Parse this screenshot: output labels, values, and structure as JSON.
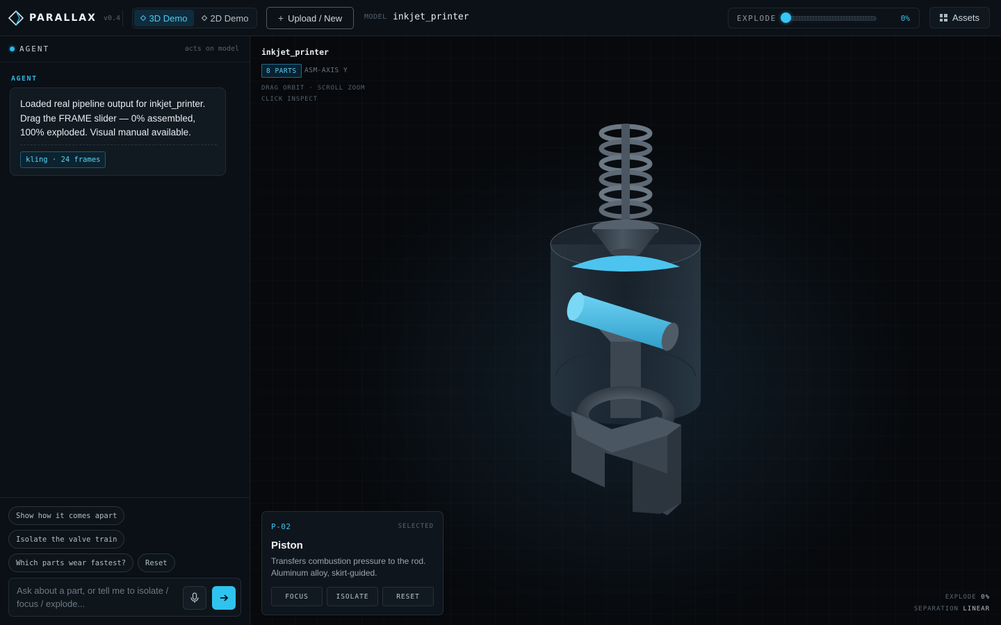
{
  "app": {
    "name": "PARALLAX",
    "version": "v0.4"
  },
  "colors": {
    "accent": "#2fc3f0",
    "background": "#07090c",
    "panel": "#0b1016"
  },
  "topbar": {
    "modes": [
      {
        "label": "3D Demo",
        "active": true,
        "icon": "diamond-icon"
      },
      {
        "label": "2D Demo",
        "active": false,
        "icon": "diamond-icon"
      }
    ],
    "upload_label": "Upload / New",
    "model_label": "MODEL",
    "model_name": "inkjet_printer",
    "explode": {
      "label": "EXPLODE",
      "value": 0,
      "value_text": "0%"
    },
    "assets_label": "Assets"
  },
  "agent_panel": {
    "title": "AGENT",
    "acts_on": "acts on model",
    "section_label": "AGENT",
    "message": "Loaded real pipeline output for inkjet_printer. Drag the FRAME slider — 0% assembled, 100% exploded. Visual manual available.",
    "message_tag": "kling · 24 frames",
    "suggestions": [
      "Show how it comes apart",
      "Isolate the valve train",
      "Which parts wear fastest?",
      "Reset"
    ],
    "input_placeholder": "Ask about a part, or tell me to isolate / focus / explode..."
  },
  "viewport": {
    "model_title": "inkjet_printer",
    "parts_badge": "8 PARTS",
    "axis": "ASM-AXIS Y",
    "hint_line1": "DRAG ORBIT · SCROLL ZOOM",
    "hint_line2": "CLICK INSPECT",
    "selected_part": {
      "id": "P-02",
      "status": "SELECTED",
      "name": "Piston",
      "description": "Transfers combustion pressure to the rod. Aluminum alloy, skirt-guided.",
      "actions": [
        "FOCUS",
        "ISOLATE",
        "RESET"
      ]
    },
    "status": {
      "explode_label": "EXPLODE",
      "explode_value": "0%",
      "separation_label": "SEPARATION",
      "separation_value": "LINEAR"
    }
  }
}
